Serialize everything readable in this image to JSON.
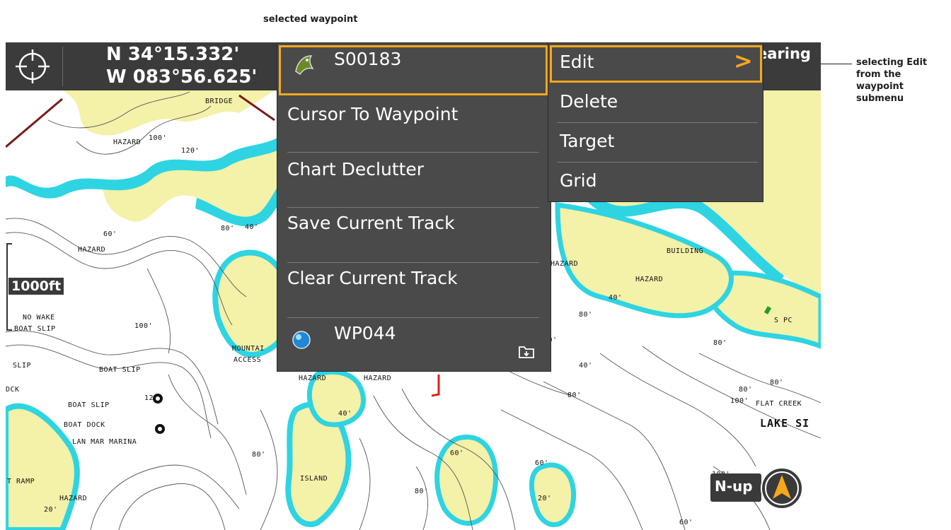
{
  "callouts": {
    "top": "selected waypoint",
    "right": "selecting Edit\nfrom the\nwaypoint\nsubmenu"
  },
  "statusbar": {
    "latitude": "N 34°15.332'",
    "longitude": "W 083°56.625'",
    "bearing": "earing"
  },
  "scale": "1000ft",
  "orientation": "N-up",
  "map_labels": [
    {
      "text": "BRIDGE"
    },
    {
      "text": "HAZARD"
    },
    {
      "text": "100'"
    },
    {
      "text": "120'"
    },
    {
      "text": "60'"
    },
    {
      "text": "HAZARD"
    },
    {
      "text": "80'"
    },
    {
      "text": "40'"
    },
    {
      "text": "NO WAKE"
    },
    {
      "text": "BOAT SLIP"
    },
    {
      "text": "100'"
    },
    {
      "text": "SLIP"
    },
    {
      "text": "BOAT SLIP"
    },
    {
      "text": "MOUNTAI"
    },
    {
      "text": "ACCESS"
    },
    {
      "text": "DCK"
    },
    {
      "text": "BOAT SLIP"
    },
    {
      "text": "12"
    },
    {
      "text": "BOAT DOCK"
    },
    {
      "text": "LAN MAR MARINA"
    },
    {
      "text": "T RAMP"
    },
    {
      "text": "HAZARD"
    },
    {
      "text": "20'"
    },
    {
      "text": "80'"
    },
    {
      "text": "ISLAND"
    },
    {
      "text": "80'"
    },
    {
      "text": "40'"
    },
    {
      "text": "HAZARD"
    },
    {
      "text": "HAZARD"
    },
    {
      "text": "60'"
    },
    {
      "text": "20'"
    },
    {
      "text": "60'"
    },
    {
      "text": "80'"
    },
    {
      "text": "80'"
    },
    {
      "text": "40'"
    },
    {
      "text": "HAZARD"
    },
    {
      "text": "BUILDING"
    },
    {
      "text": "HAZARD"
    },
    {
      "text": "40'"
    },
    {
      "text": "80'"
    },
    {
      "text": "40'"
    },
    {
      "text": "80'"
    },
    {
      "text": "S PC"
    },
    {
      "text": "80'"
    },
    {
      "text": "100'"
    },
    {
      "text": "FLAT CREEK"
    },
    {
      "text": "LAKE SI"
    },
    {
      "text": "100'"
    },
    {
      "text": "60'"
    }
  ],
  "menu": {
    "waypoint_name": "S00183",
    "items": [
      "Cursor To Waypoint",
      "Chart Declutter",
      "Save Current Track",
      "Clear Current Track"
    ],
    "second_waypoint": "WP044"
  },
  "submenu": {
    "items": [
      "Edit",
      "Delete",
      "Target",
      "Grid"
    ],
    "chevron": ">"
  },
  "colors": {
    "land": "#f4f1a8",
    "shallow": "#2ed4e2",
    "water": "#ffffff",
    "menu_bg": "#4a4a4a",
    "highlight": "#f5a81c"
  }
}
